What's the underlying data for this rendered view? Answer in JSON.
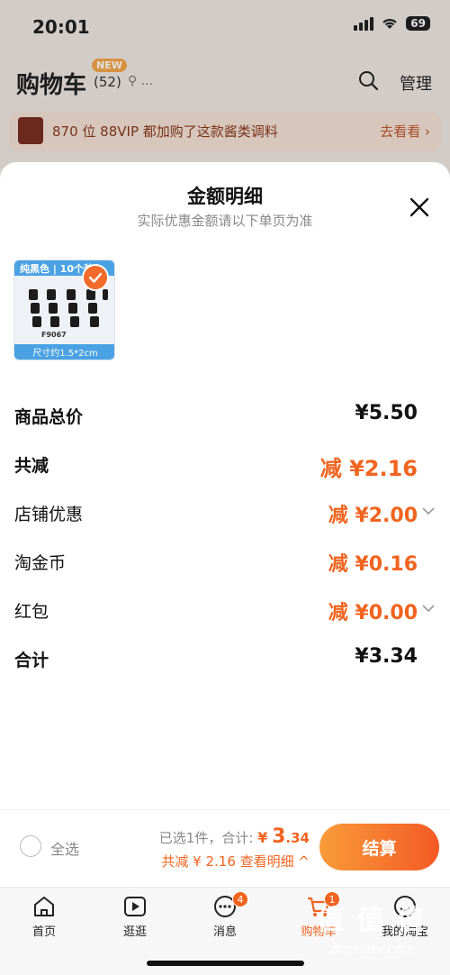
{
  "status_bar": {
    "time": "20:01",
    "battery": "69"
  },
  "cart_header": {
    "title": "购物车",
    "new_badge": "NEW",
    "count": "(52)",
    "location": "...",
    "manage": "管理"
  },
  "promo": {
    "text": "870 位 88VIP 都加购了这款酱类调料",
    "link": "去看看 ›"
  },
  "sheet": {
    "title": "金额明细",
    "subtitle": "实际优惠金额请以下单页为准",
    "product": {
      "top_text": "纯黑色 | 10个装",
      "code": "F9067",
      "bottom_text": "尺寸约1.5*2cm"
    },
    "rows": {
      "subtotal": {
        "label": "商品总价",
        "value": "¥5.50"
      },
      "total_discount": {
        "label": "共减",
        "value": "减 ¥2.16"
      },
      "store": {
        "label": "店铺优惠",
        "value": "减 ¥2.00"
      },
      "coins": {
        "label": "淘金币",
        "value": "减 ¥0.16"
      },
      "redpacket": {
        "label": "红包",
        "value": "减 ¥0.00"
      },
      "total": {
        "label": "合计",
        "value": "¥3.34"
      }
    }
  },
  "checkout": {
    "select_all": "全选",
    "selected_prefix": "已选1件，合计:",
    "total_yen": "¥",
    "total_int": "3",
    "total_dec": ".34",
    "discount_text": "共减 ¥ 2.16  查看明细 ^",
    "button": "结算"
  },
  "tabbar": {
    "tabs": [
      {
        "label": "首页"
      },
      {
        "label": "逛逛"
      },
      {
        "label": "消息",
        "badge": "4"
      },
      {
        "label": "购物车",
        "badge": "1"
      },
      {
        "label": "我的淘宝"
      }
    ]
  },
  "watermark": {
    "main": "值 值 值",
    "sub": "zhizhizhi.com"
  },
  "colors": {
    "accent": "#f0641f",
    "sheet_bg": "#ffffff",
    "dim_bg": "#efe9e4"
  }
}
